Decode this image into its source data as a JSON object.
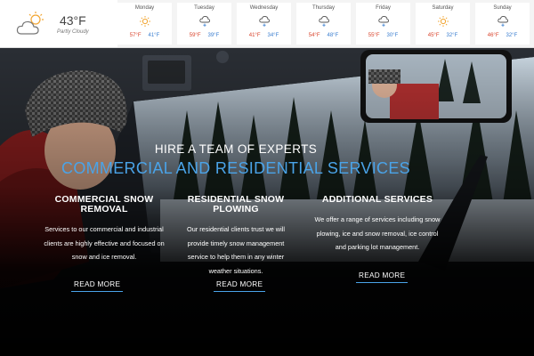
{
  "weather": {
    "current": {
      "temp": "43°F",
      "condition": "Partly Cloudy",
      "icon": "partly-cloudy-icon"
    },
    "forecast": [
      {
        "day": "Monday",
        "icon": "sun-icon",
        "high": "57°F",
        "low": "41°F"
      },
      {
        "day": "Tuesday",
        "icon": "snow-cloud-icon",
        "high": "59°F",
        "low": "39°F"
      },
      {
        "day": "Wednesday",
        "icon": "snow-cloud-icon",
        "high": "41°F",
        "low": "34°F"
      },
      {
        "day": "Thursday",
        "icon": "snow-cloud-icon",
        "high": "54°F",
        "low": "48°F"
      },
      {
        "day": "Friday",
        "icon": "snow-cloud-icon",
        "high": "55°F",
        "low": "30°F"
      },
      {
        "day": "Saturday",
        "icon": "sun-icon",
        "high": "45°F",
        "low": "32°F"
      },
      {
        "day": "Sunday",
        "icon": "snow-cloud-icon",
        "high": "46°F",
        "low": "32°F"
      }
    ],
    "colors": {
      "high": "#d9442c",
      "low": "#3b7fd0",
      "sun": "#f2a531"
    }
  },
  "hero": {
    "headline": "HIRE A TEAM OF EXPERTS",
    "subheadline": "COMMERCIAL AND RESIDENTIAL SERVICES",
    "accent": "#4aa3e8"
  },
  "services": [
    {
      "title": "COMMERCIAL SNOW REMOVAL",
      "text": "Services to our commercial and industrial clients are highly effective and focused on snow and ice removal.",
      "button": "READ MORE"
    },
    {
      "title": "RESIDENTIAL SNOW PLOWING",
      "text": "Our residential clients trust we will provide timely snow management service to help them in any winter weather situations.",
      "button": "READ MORE"
    },
    {
      "title": "ADDITIONAL SERVICES",
      "text": "We offer a range of services including snow plowing, ice and snow removal, ice control and parking lot management.",
      "button": "READ MORE"
    }
  ]
}
